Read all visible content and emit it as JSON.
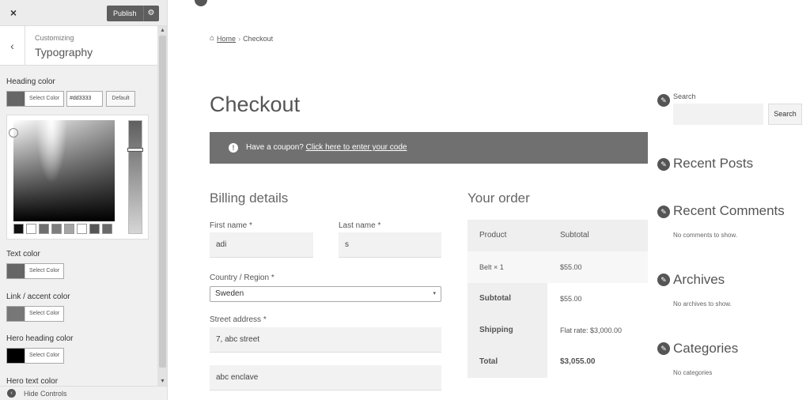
{
  "sidebar": {
    "close_icon": "×",
    "publish_label": "Publish",
    "gear_icon": "⚙",
    "back_icon": "‹",
    "section_parent": "Customizing",
    "section_title": "Typography",
    "scroll_up_icon": "▴",
    "scroll_down_icon": "▾",
    "heading_color_label": "Heading color",
    "select_color_label": "Select Color",
    "hex_value": "#dd3333",
    "default_label": "Default",
    "text_color_label": "Text color",
    "link_color_label": "Link / accent color",
    "hero_heading_label": "Hero heading color",
    "hero_text_label": "Hero text color",
    "hide_controls_label": "Hide Controls",
    "palette": [
      "#111111",
      "#ffffff",
      "#6e6e6e",
      "#7d7d7d",
      "#a5a5a5",
      "#ffffff",
      "#555555",
      "#6a6a6a"
    ],
    "colors": {
      "heading": "#666666",
      "text": "#666666",
      "link": "#777777",
      "hero_heading": "#000000"
    }
  },
  "preview": {
    "home_icon": "⌂",
    "breadcrumb_home": "Home",
    "breadcrumb_sep": "›",
    "breadcrumb_current": "Checkout",
    "page_title": "Checkout",
    "coupon_icon": "!",
    "coupon_text": "Have a coupon?",
    "coupon_link": "Click here to enter your code",
    "billing_title": "Billing details",
    "first_name_label": "First name *",
    "first_name_value": "adi",
    "last_name_label": "Last name *",
    "last_name_value": "s",
    "country_label": "Country / Region *",
    "country_value": "Sweden",
    "select_arrow": "▾",
    "street_label": "Street address *",
    "street_value_1": "7, abc street",
    "street_value_2": "abc enclave",
    "order_title": "Your order",
    "order": {
      "product_header": "Product",
      "subtotal_header": "Subtotal",
      "item_name": "Belt  × 1",
      "item_price": "$55.00",
      "subtotal_label": "Subtotal",
      "subtotal_value": "$55.00",
      "shipping_label": "Shipping",
      "shipping_value": "Flat rate: $3,000.00",
      "total_label": "Total",
      "total_value": "$3,055.00"
    },
    "widgets": {
      "icon": "✎",
      "search_title": "Search",
      "search_button": "Search",
      "recent_posts": "Recent Posts",
      "recent_comments": "Recent Comments",
      "no_comments": "No comments to show.",
      "archives": "Archives",
      "no_archives": "No archives to show.",
      "categories": "Categories",
      "no_categories": "No categories"
    }
  }
}
